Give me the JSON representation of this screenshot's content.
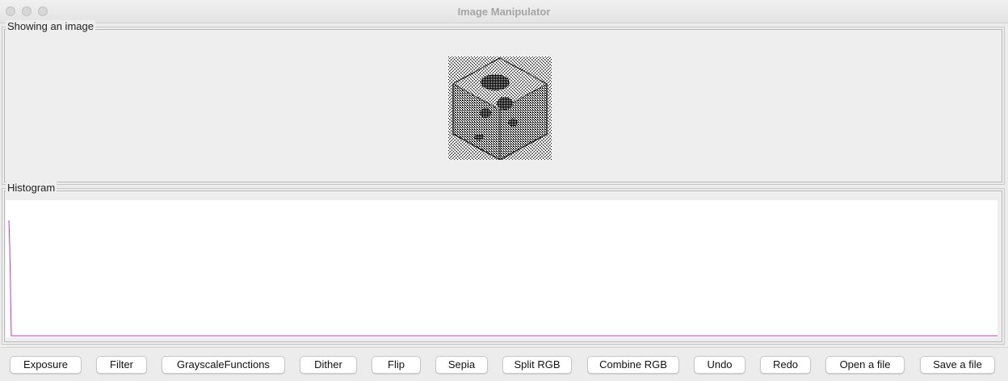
{
  "window": {
    "title": "Image Manipulator"
  },
  "image_panel": {
    "legend": "Showing an image"
  },
  "histogram_panel": {
    "legend": "Histogram",
    "line_color": "#cc33cc"
  },
  "buttons": [
    {
      "label": "Exposure"
    },
    {
      "label": "Filter"
    },
    {
      "label": "GrayscaleFunctions"
    },
    {
      "label": "Dither"
    },
    {
      "label": "Flip"
    },
    {
      "label": "Sepia"
    },
    {
      "label": "Split RGB"
    },
    {
      "label": "Combine RGB"
    },
    {
      "label": "Undo"
    },
    {
      "label": "Redo"
    },
    {
      "label": "Open a file"
    },
    {
      "label": "Save a file"
    }
  ]
}
